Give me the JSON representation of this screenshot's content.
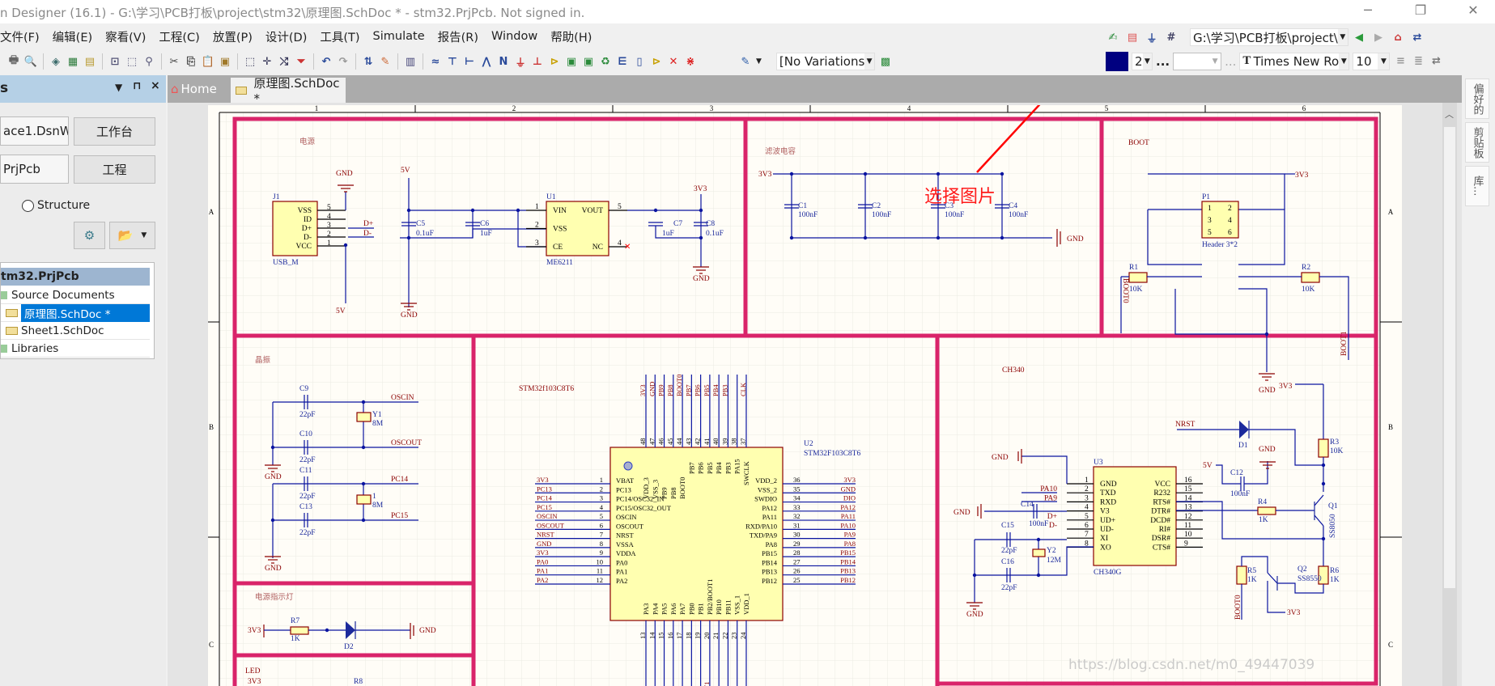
{
  "window": {
    "title": "n Designer (16.1) - G:\\学习\\PCB打板\\project\\stm32\\原理图.SchDoc * - stm32.PrjPcb. Not signed in.",
    "minimize": "─",
    "maximize": "❐",
    "close": "✕"
  },
  "menu": [
    "文件(F)",
    "编辑(E)",
    "察看(V)",
    "工程(C)",
    "放置(P)",
    "设计(D)",
    "工具(T)",
    "Simulate",
    "报告(R)",
    "Window",
    "帮助(H)"
  ],
  "toolbar": {
    "icons": [
      {
        "n": "print",
        "g": "🖶",
        "c": "#666"
      },
      {
        "n": "print-preview",
        "g": "🔍",
        "c": "#666"
      },
      {
        "s": 1
      },
      {
        "n": "3d-view",
        "g": "◈",
        "c": "#3a6a6a"
      },
      {
        "n": "pcb-board",
        "g": "▦",
        "c": "#2a7a3a"
      },
      {
        "n": "document",
        "g": "▤",
        "c": "#b89a30"
      },
      {
        "s": 1
      },
      {
        "n": "zoom-fit",
        "g": "⊡",
        "c": "#557"
      },
      {
        "n": "zoom-area",
        "g": "⬚",
        "c": "#557"
      },
      {
        "n": "zoom-selected",
        "g": "⚲",
        "c": "#557"
      },
      {
        "s": 1
      },
      {
        "n": "cut",
        "g": "✂",
        "c": "#444"
      },
      {
        "n": "copy",
        "g": "⎘",
        "c": "#444"
      },
      {
        "n": "paste",
        "g": "📋",
        "c": "#a07828"
      },
      {
        "n": "rubber-stamp",
        "g": "▣",
        "c": "#a07828"
      },
      {
        "s": 1
      },
      {
        "n": "select-area",
        "g": "⬚",
        "c": "#335"
      },
      {
        "n": "move",
        "g": "✛",
        "c": "#335"
      },
      {
        "n": "deselect",
        "g": "⤭",
        "c": "#335"
      },
      {
        "n": "clear-filter",
        "g": "⏷",
        "c": "#c33"
      },
      {
        "s": 1
      },
      {
        "n": "undo",
        "g": "↶",
        "c": "#2a4a9a"
      },
      {
        "n": "redo",
        "g": "↷",
        "c": "#999"
      },
      {
        "s": 1
      },
      {
        "n": "hierarchy",
        "g": "⇅",
        "c": "#2a4a9a"
      },
      {
        "n": "cross-probe",
        "g": "✎",
        "c": "#c63"
      },
      {
        "s": 1
      },
      {
        "n": "browse-library",
        "g": "▥",
        "c": "#447"
      },
      {
        "s": 1
      },
      {
        "n": "bus",
        "g": "≈",
        "c": "#2a4a9a"
      },
      {
        "n": "bus-entry",
        "g": "⊤",
        "c": "#2a4a9a"
      },
      {
        "n": "wire",
        "g": "⊢",
        "c": "#2a4a9a"
      },
      {
        "n": "signal-harness",
        "g": "⋀",
        "c": "#2a4a9a"
      },
      {
        "n": "net-label",
        "g": "N",
        "c": "#2a4a9a"
      },
      {
        "n": "gnd-port",
        "g": "⏚",
        "c": "#c33"
      },
      {
        "n": "vcc-port",
        "g": "⊥",
        "c": "#c33"
      },
      {
        "n": "part",
        "g": "⊳",
        "c": "#c8a000"
      },
      {
        "n": "sheet-symbol",
        "g": "▣",
        "c": "#2a8a3a"
      },
      {
        "n": "sheet-entry",
        "g": "▣",
        "c": "#2a8a3a"
      },
      {
        "n": "device-sheet",
        "g": "♻",
        "c": "#2a8a3a"
      },
      {
        "n": "harness-connector",
        "g": "⋿",
        "c": "#2a4a9a"
      },
      {
        "n": "harness-entry",
        "g": "▯",
        "c": "#2a4a9a"
      },
      {
        "n": "port",
        "g": "⊳",
        "c": "#c8a000"
      },
      {
        "n": "no-erc",
        "g": "✕",
        "c": "#d22"
      },
      {
        "n": "compile-mask",
        "g": "⋇",
        "c": "#d22"
      }
    ],
    "right_row1": [
      {
        "n": "place-utility",
        "g": "✍",
        "c": "#2a8a3a"
      },
      {
        "n": "align",
        "g": "▤",
        "c": "#d55"
      },
      {
        "n": "power-objects",
        "g": "⏚",
        "c": "#2a4a9a"
      },
      {
        "n": "grid",
        "g": "#",
        "c": "#446"
      }
    ],
    "path_combo": "G:\\学习\\PCB打板\\project\\",
    "nav_icons": [
      {
        "n": "back",
        "g": "◀",
        "c": "#2a9a3a"
      },
      {
        "n": "forward",
        "g": "▶",
        "c": "#aaa"
      },
      {
        "n": "home",
        "g": "⌂",
        "c": "#c33"
      },
      {
        "n": "refresh",
        "g": "⇄",
        "c": "#2a4a9a"
      }
    ],
    "variations": "[No Variations",
    "line_width": "2",
    "ellipsis": "...",
    "font_name": "Times New Ro",
    "font_size": "10",
    "color_swatch": "#000080"
  },
  "panel": {
    "title": "s",
    "workspace_combo": "ace1.DsnW",
    "workspace_button": "工作台",
    "project_field": "PrjPcb",
    "project_button": "工程",
    "structure_radio": "Structure",
    "tree": {
      "root": "tm32.PrjPcb",
      "items": [
        {
          "label": "Source Documents",
          "level": 0
        },
        {
          "label": "原理图.SchDoc *",
          "level": 1,
          "selected": true
        },
        {
          "label": "Sheet1.SchDoc",
          "level": 1
        },
        {
          "label": "Libraries",
          "level": 0
        }
      ]
    }
  },
  "tabs": [
    {
      "label": "Home"
    },
    {
      "label": "原理图.SchDoc *",
      "active": true
    }
  ],
  "right_panel": [
    "偏好的",
    "剪贴板",
    "库..."
  ],
  "sheet": {
    "col_marks": [
      "1",
      "2",
      "3",
      "4",
      "5",
      "6"
    ],
    "row_marks": [
      "A",
      "B",
      "C"
    ],
    "annotation": "选择图片",
    "colors": {
      "frame": "#d9246a",
      "wire": "#0a14a0",
      "net": "#8b0000",
      "part_fill": "#ffffb0"
    },
    "sections": {
      "power": {
        "title": "电源",
        "j1": "J1",
        "j1_type": "USB_M",
        "j1_pins": [
          [
            "VSS",
            "5"
          ],
          [
            "ID",
            "4"
          ],
          [
            "D+",
            "3"
          ],
          [
            "D-",
            "2"
          ],
          [
            "VCC",
            "1"
          ]
        ],
        "gnd": "GND",
        "v5": "5V",
        "dp": "D+",
        "dm": "D-",
        "c5": "C5",
        "c5v": "0.1uF",
        "c6": "C6",
        "c6v": "1uF",
        "u1": "U1",
        "u1_type": "ME6211",
        "u1_left": [
          [
            "VIN",
            "1"
          ],
          [
            "VSS",
            "2"
          ],
          [
            "CE",
            "3"
          ]
        ],
        "u1_right": [
          [
            "VOUT",
            "5"
          ],
          [
            "NC",
            "4"
          ]
        ],
        "c7": "C7",
        "c7v": "1uF",
        "c8": "C8",
        "c8v": "0.1uF",
        "v33": "3V3"
      },
      "filter": {
        "title": "滤波电容",
        "v33": "3V3",
        "gnd": "GND",
        "caps": [
          [
            "C1",
            "100nF"
          ],
          [
            "C2",
            "100nF"
          ],
          [
            "C3",
            "100nF"
          ],
          [
            "C4",
            "100nF"
          ]
        ]
      },
      "boot": {
        "title": "BOOT",
        "v33": "3V3",
        "p1": "P1",
        "p1_type": "Header 3*2",
        "pins": [
          "1",
          "2",
          "3",
          "4",
          "5",
          "6"
        ],
        "r1": "R1",
        "r1v": "10K",
        "r2": "R2",
        "r2v": "10K",
        "boot0": "BOOT0",
        "boot1": "BOOT1",
        "gnd": "GND"
      },
      "crystal": {
        "title": "晶振",
        "c9": "C9",
        "c10": "C10",
        "c11": "C11",
        "c13": "C13",
        "cv": "22pF",
        "y1": "Y1",
        "y1v": "8M",
        "y_other": "1",
        "y_otherv": "8M",
        "oscin": "OSCIN",
        "oscout": "OSCOUT",
        "pc14": "PC14",
        "pc15": "PC15",
        "gnd": "GND"
      },
      "power_led": {
        "title": "电源指示灯",
        "v33": "3V3",
        "r7": "R7",
        "r7v": "1K",
        "d2": "D2",
        "gnd": "GND"
      },
      "led": {
        "title": "LED",
        "v33": "3V3",
        "r8": "R8"
      },
      "mcu": {
        "title": "STM32f103C8T6",
        "designator": "U2",
        "type": "STM32F103C8T6",
        "left": [
          [
            "1",
            "VBAT",
            "3V3"
          ],
          [
            "2",
            "PC13",
            "PC13"
          ],
          [
            "3",
            "PC14/OSC32_IN",
            "PC14"
          ],
          [
            "4",
            "PC15/OSC32_OUT",
            "PC15"
          ],
          [
            "5",
            "OSCIN",
            "OSCIN"
          ],
          [
            "6",
            "OSCOUT",
            "OSCOUT"
          ],
          [
            "7",
            "NRST",
            "NRST"
          ],
          [
            "8",
            "VSSA",
            "GND"
          ],
          [
            "9",
            "VDDA",
            "3V3"
          ],
          [
            "10",
            "PA0",
            "PA0"
          ],
          [
            "11",
            "PA1",
            "PA1"
          ],
          [
            "12",
            "PA2",
            "PA2"
          ]
        ],
        "right": [
          [
            "36",
            "VDD_2",
            "3V3"
          ],
          [
            "35",
            "VSS_2",
            "GND"
          ],
          [
            "34",
            "SWDIO",
            "DIO"
          ],
          [
            "33",
            "PA12",
            "PA12"
          ],
          [
            "32",
            "PA11",
            "PA11"
          ],
          [
            "31",
            "RXD/PA10",
            "PA10"
          ],
          [
            "30",
            "TXD/PA9",
            "PA9"
          ],
          [
            "29",
            "PA8",
            "PA8"
          ],
          [
            "28",
            "PB15",
            "PB15"
          ],
          [
            "27",
            "PB14",
            "PB14"
          ],
          [
            "26",
            "PB13",
            "PB13"
          ],
          [
            "25",
            "PB12",
            "PB12"
          ]
        ],
        "top": [
          [
            "48",
            "VDD_3",
            "3V3"
          ],
          [
            "47",
            "VSS_3",
            "GND"
          ],
          [
            "46",
            "PB9",
            "PB9"
          ],
          [
            "45",
            "PB8",
            "PB8"
          ],
          [
            "44",
            "BOOT0",
            "BOOT0"
          ],
          [
            "43",
            "PB7",
            "PB7"
          ],
          [
            "42",
            "PB6",
            "PB6"
          ],
          [
            "41",
            "PB5",
            "PB5"
          ],
          [
            "40",
            "PB4",
            "PB4"
          ],
          [
            "39",
            "PB3",
            "PB3"
          ],
          [
            "38",
            "PA15",
            ""
          ],
          [
            "37",
            "SWCLK",
            "CLK"
          ]
        ],
        "bottom": [
          [
            "13",
            "PA3",
            "PA3"
          ],
          [
            "14",
            "PA4",
            "PA4"
          ],
          [
            "15",
            "PA5",
            "PA5"
          ],
          [
            "16",
            "PA6",
            "PA6"
          ],
          [
            "17",
            "PA7",
            "PA7"
          ],
          [
            "18",
            "PB0",
            "PB0"
          ],
          [
            "19",
            "PB1",
            "PB1"
          ],
          [
            "20",
            "PB2/BOOT1",
            "BOOT1"
          ],
          [
            "21",
            "PB10",
            "PB10"
          ],
          [
            "22",
            "PB11",
            "PB11"
          ],
          [
            "23",
            "VSS_1",
            "GND"
          ],
          [
            "24",
            "VDD_1",
            "3V3"
          ]
        ]
      },
      "usb_uart": {
        "title": "CH340",
        "designator": "U3",
        "type": "CH340G",
        "left": [
          [
            "1",
            "GND",
            ""
          ],
          [
            "2",
            "TXD",
            "PA10"
          ],
          [
            "3",
            "RXD",
            "PA9"
          ],
          [
            "4",
            "V3",
            ""
          ],
          [
            "5",
            "UD+",
            "D+"
          ],
          [
            "6",
            "UD-",
            "D-"
          ],
          [
            "7",
            "XI",
            ""
          ],
          [
            "8",
            "XO",
            ""
          ]
        ],
        "right": [
          [
            "16",
            "VCC"
          ],
          [
            "15",
            "R232"
          ],
          [
            "14",
            "RTS#"
          ],
          [
            "13",
            "DTR#"
          ],
          [
            "12",
            "DCD#"
          ],
          [
            "11",
            "RI#"
          ],
          [
            "10",
            "DSR#"
          ],
          [
            "9",
            "CTS#"
          ]
        ],
        "gnd": "GND",
        "v5": "5V",
        "v33": "3V3",
        "nrst": "NRST",
        "d1": "D1",
        "c12": "C12",
        "c12v": "100nF",
        "c14": "C14",
        "c14v": "100nF",
        "c15": "C15",
        "c16": "C16",
        "cv": "22pF",
        "y2": "Y2",
        "y2v": "12M",
        "r3": "R3",
        "r3v": "10K",
        "r4": "R4",
        "r4v": "1K",
        "r5": "R5",
        "r5v": "1K",
        "r6": "R6",
        "r6v": "1K",
        "q1": "Q1",
        "q1_type": "SS8050",
        "q2": "Q2",
        "q2_type": "SS8550",
        "boot0": "BOOT0"
      }
    }
  },
  "watermark": "https://blog.csdn.net/m0_49447039"
}
